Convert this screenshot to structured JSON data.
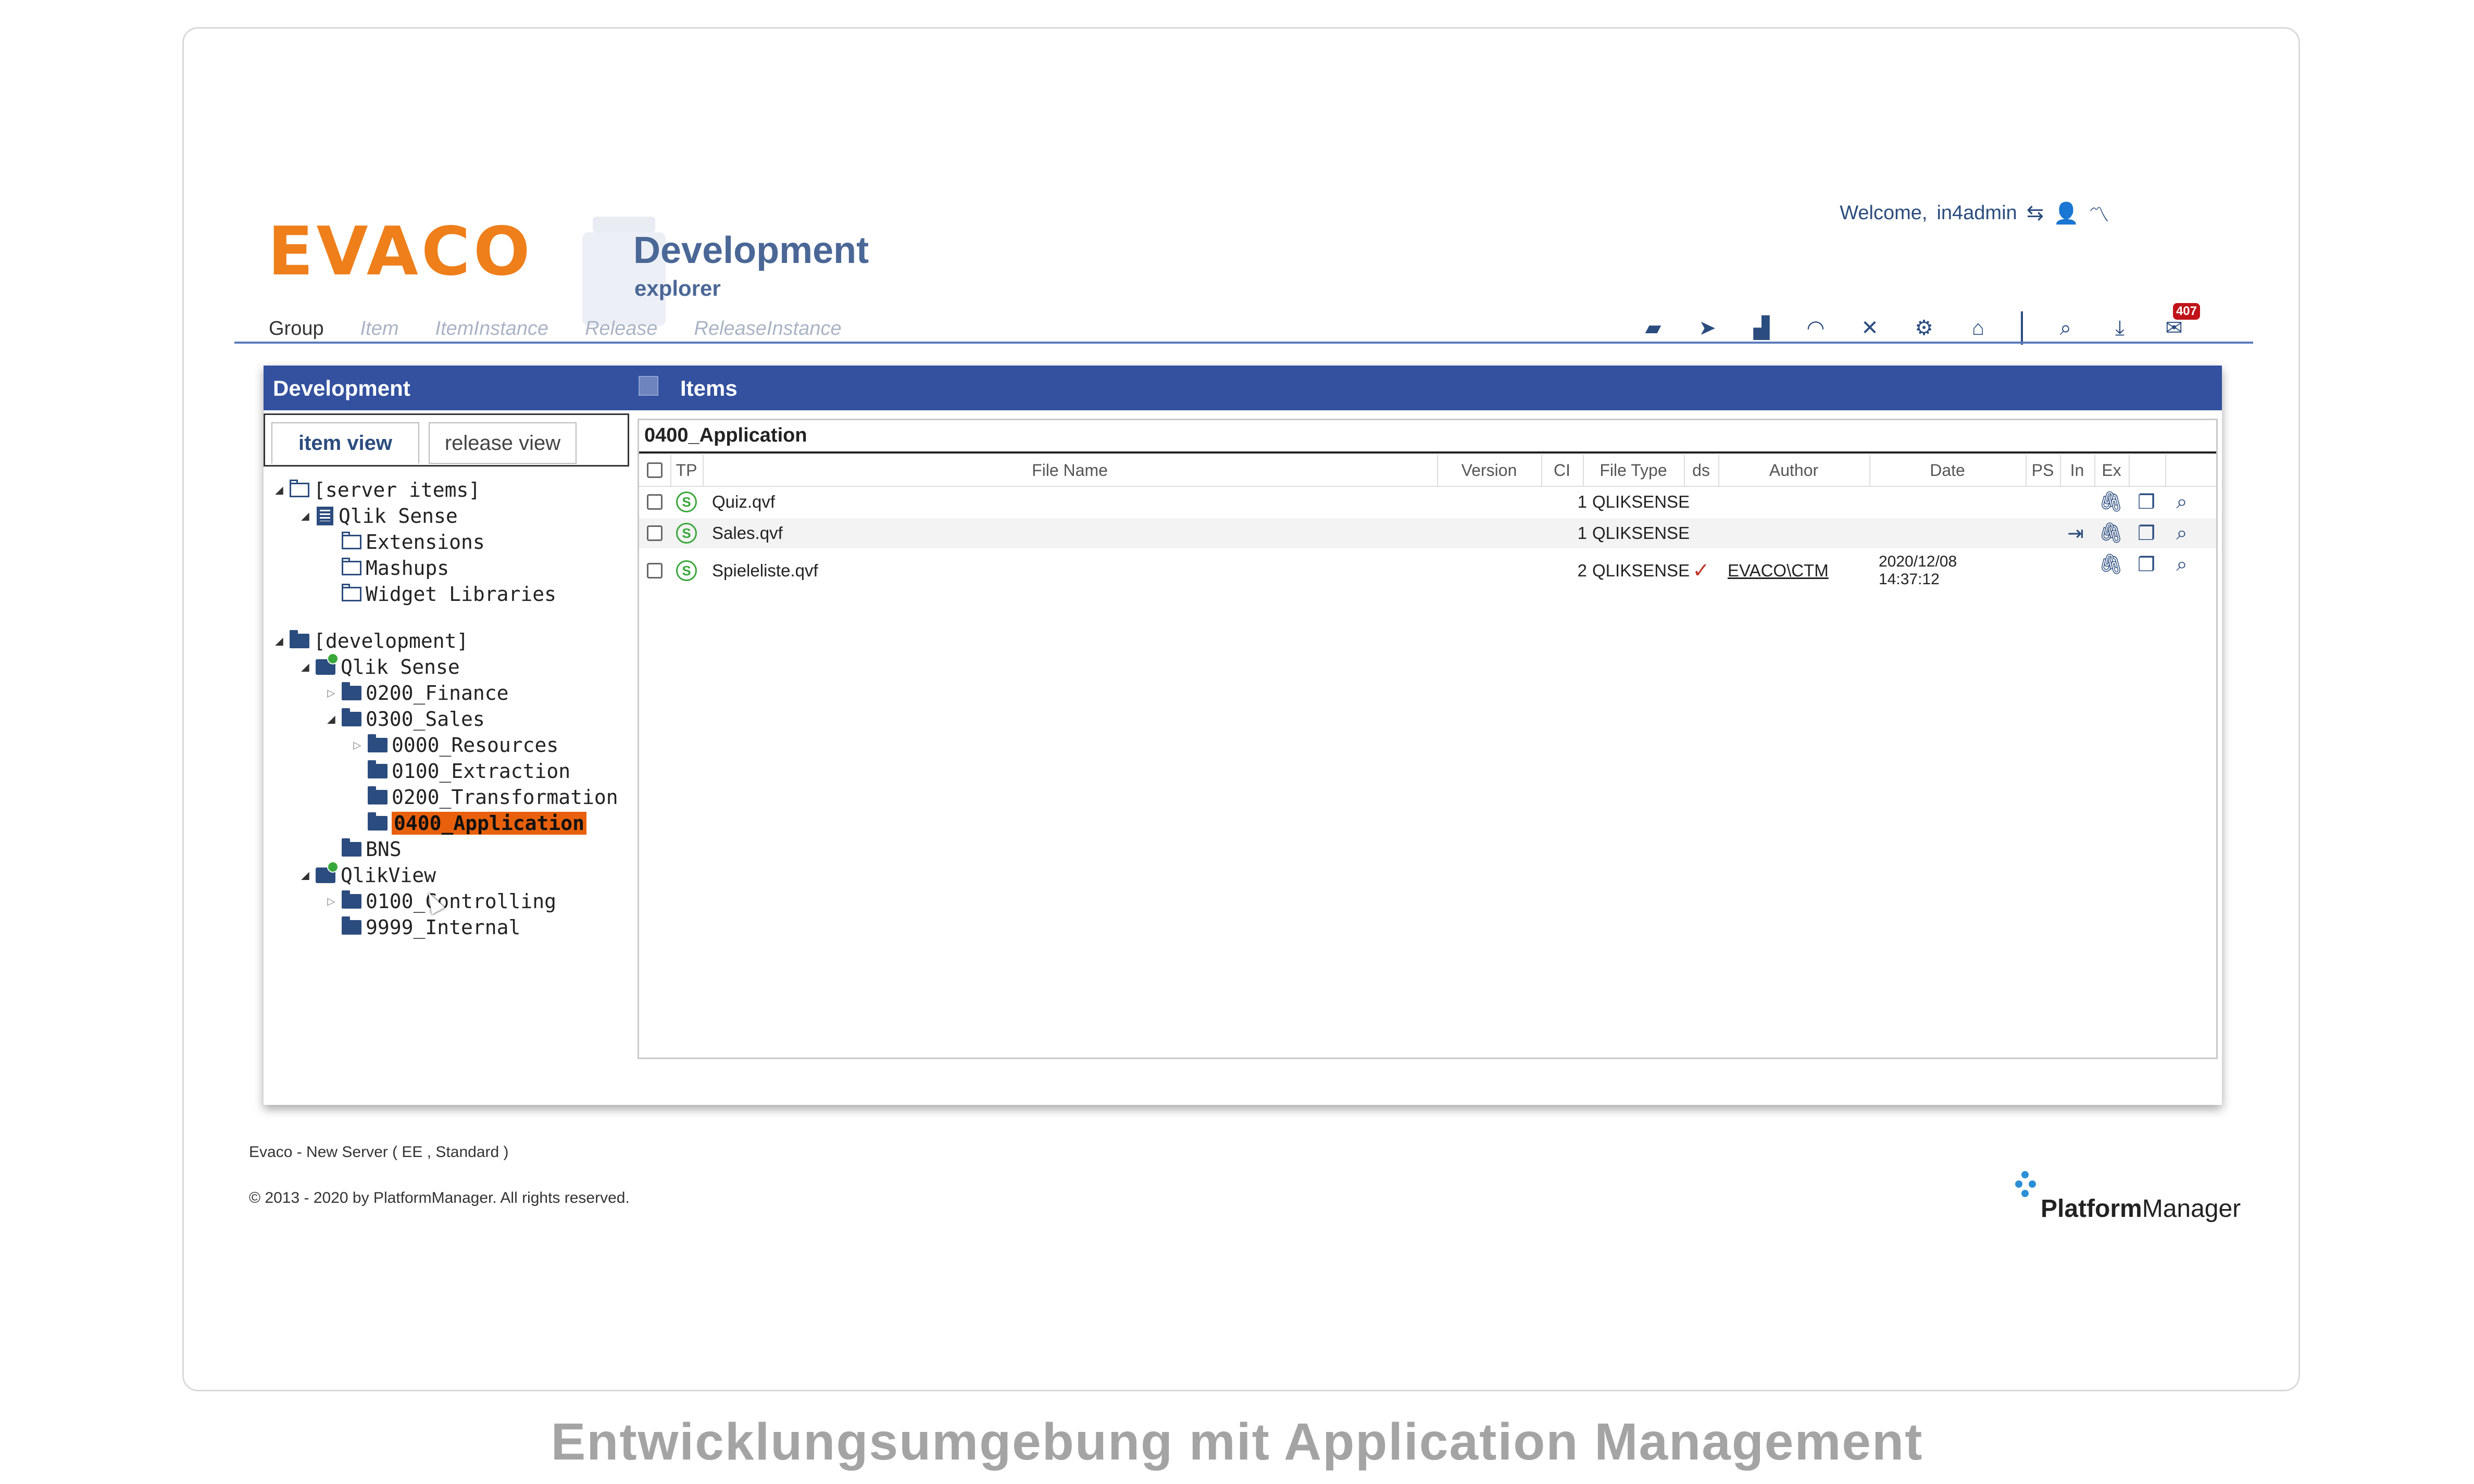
{
  "header": {
    "logo_text": "EVACO",
    "app_title": "Development",
    "app_subtitle": "explorer",
    "welcome_label": "Welcome,",
    "username": "in4admin"
  },
  "nav": [
    "Group",
    "Item",
    "ItemInstance",
    "Release",
    "ReleaseInstance"
  ],
  "toolbar": {
    "icons": [
      "briefcase-icon",
      "send-icon",
      "bar-chart-icon",
      "speedometer-icon",
      "tools-icon",
      "gear-icon",
      "home-icon",
      "search-icon",
      "download-icon",
      "mail-icon"
    ],
    "mail_badge": "407"
  },
  "panel": {
    "left_title": "Development",
    "right_title": "Items",
    "tabs": [
      "item view",
      "release view"
    ]
  },
  "tree": [
    {
      "label": "[server items]",
      "level": 0,
      "toggle": "open",
      "icon": "folder-outline"
    },
    {
      "label": "Qlik Sense",
      "level": 1,
      "toggle": "open",
      "icon": "server"
    },
    {
      "label": "Extensions",
      "level": 2,
      "toggle": "",
      "icon": "folder-outline"
    },
    {
      "label": "Mashups",
      "level": 2,
      "toggle": "",
      "icon": "folder-outline"
    },
    {
      "label": "Widget Libraries",
      "level": 2,
      "toggle": "",
      "icon": "folder-outline"
    },
    {
      "label": "[development]",
      "level": 0,
      "toggle": "open",
      "icon": "folder"
    },
    {
      "label": "Qlik Sense",
      "level": 1,
      "toggle": "open",
      "icon": "qlik"
    },
    {
      "label": "0200_Finance",
      "level": 2,
      "toggle": "closed",
      "icon": "folder"
    },
    {
      "label": "0300_Sales",
      "level": 2,
      "toggle": "open",
      "icon": "folder"
    },
    {
      "label": "0000_Resources",
      "level": 3,
      "toggle": "closed",
      "icon": "folder"
    },
    {
      "label": "0100_Extraction",
      "level": 3,
      "toggle": "",
      "icon": "folder"
    },
    {
      "label": "0200_Transformation",
      "level": 3,
      "toggle": "",
      "icon": "folder"
    },
    {
      "label": "0400_Application",
      "level": 3,
      "toggle": "",
      "icon": "folder",
      "selected": true
    },
    {
      "label": "BNS",
      "level": 2,
      "toggle": "",
      "icon": "folder"
    },
    {
      "label": "QlikView",
      "level": 1,
      "toggle": "open",
      "icon": "qlik"
    },
    {
      "label": "0100_Controlling",
      "level": 2,
      "toggle": "closed",
      "icon": "folder"
    },
    {
      "label": "9999_Internal",
      "level": 2,
      "toggle": "",
      "icon": "folder"
    }
  ],
  "items": {
    "path": "0400_Application",
    "columns": [
      "TP",
      "File Name",
      "Version",
      "CI",
      "File Type",
      "ds",
      "Author",
      "Date",
      "PS",
      "In",
      "Ex"
    ],
    "rows": [
      {
        "tp": "S",
        "file_name": "Quiz.qvf",
        "version": "",
        "ci": "1",
        "file_type": "QLIKSENSE",
        "ds": "",
        "author": "",
        "date": "",
        "date_time": "",
        "actions": [
          "attach-icon",
          "copy-icon",
          "search-icon"
        ]
      },
      {
        "tp": "S",
        "file_name": "Sales.qvf",
        "version": "",
        "ci": "1",
        "file_type": "QLIKSENSE",
        "ds": "",
        "author": "",
        "date": "",
        "date_time": "",
        "actions": [
          "sign-in-icon",
          "attach-icon",
          "copy-icon",
          "search-icon"
        ]
      },
      {
        "tp": "S",
        "file_name": "Spieleliste.qvf",
        "version": "",
        "ci": "2",
        "file_type": "QLIKSENSE",
        "ds": "✓",
        "author": "EVACO\\CTM",
        "date": "2020/12/08",
        "date_time": "14:37:12",
        "actions": [
          "attach-icon",
          "copy-icon",
          "search-icon"
        ]
      }
    ]
  },
  "footer": {
    "server_info": "Evaco - New Server ( EE , Standard )",
    "copyright": "© 2013 - 2020 by PlatformManager. All rights reserved.",
    "brand_bold": "Platform",
    "brand_rest": "Manager"
  },
  "caption": "Entwicklungsumgebung mit Application Management",
  "colors": {
    "accent_orange": "#ee7f1a",
    "panel_header": "#33519e",
    "selected": "#e8600c",
    "brand_blue": "#2b4c7e",
    "qlik_green": "#39a83a"
  }
}
